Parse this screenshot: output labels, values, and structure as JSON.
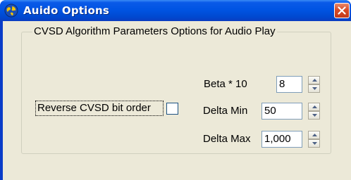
{
  "window": {
    "title": "Auido Options"
  },
  "group": {
    "legend": "CVSD Algorithm Parameters Options for Audio Play"
  },
  "options": {
    "reverse_label": "Reverse CVSD bit order",
    "reverse_checked": false
  },
  "fields": {
    "beta": {
      "label": "Beta * 10",
      "value": "8"
    },
    "delta_min": {
      "label": "Delta Min",
      "value": "50"
    },
    "delta_max": {
      "label": "Delta Max",
      "value": "1,000"
    }
  },
  "colors": {
    "title_bar": "#0054e3",
    "close_button": "#d84b26",
    "client_background": "#ece9d8"
  },
  "icons": {
    "app_icon": "globe-icon",
    "close_icon": "close-icon",
    "spin_up": "arrow-up-icon",
    "spin_down": "arrow-down-icon"
  }
}
